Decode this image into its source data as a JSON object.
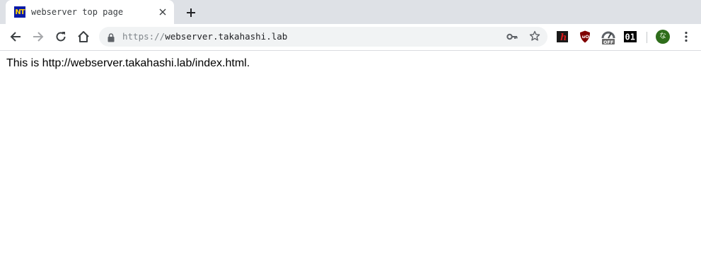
{
  "tab": {
    "favicon_text": "NT",
    "title": "webserver top page",
    "close_glyph": "✕",
    "favicon_colors": {
      "bg": "#0a1aa8",
      "fg": "#ffd400"
    }
  },
  "toolbar": {
    "back_icon": "arrow-left-icon",
    "forward_icon": "arrow-right-icon",
    "reload_icon": "reload-icon",
    "home_icon": "home-icon"
  },
  "omnibox": {
    "scheme": "https://",
    "host": "webserver.takahashi.lab",
    "lock_icon": "lock-icon",
    "key_icon": "key-icon",
    "star_icon": "star-icon"
  },
  "extensions": [
    {
      "name": "h-extension-icon",
      "glyph": "h",
      "bg": "#1a1a1a",
      "fg": "#d11a1a"
    },
    {
      "name": "ublock-shield-icon",
      "glyph": "uO",
      "bg": "#800000",
      "fg": "#ffffff"
    },
    {
      "name": "speed-gauge-off-icon",
      "badge": "OFF"
    },
    {
      "name": "binary-01-icon",
      "glyph": "01",
      "bg": "#000000",
      "fg": "#ffffff"
    }
  ],
  "profile": {
    "avatar_glyph": "な",
    "color": "#2e6d1b"
  },
  "page": {
    "text": "This is http://webserver.takahashi.lab/index.html."
  }
}
